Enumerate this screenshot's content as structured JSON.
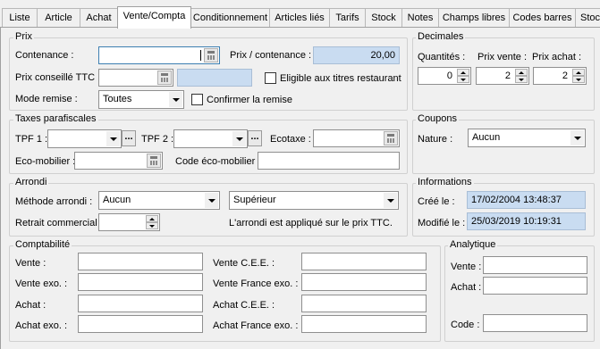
{
  "tabs": [
    "Liste",
    "Article",
    "Achat",
    "Vente/Compta",
    "Conditionnement",
    "Articles liés",
    "Tarifs",
    "Stock",
    "Notes",
    "Champs libres",
    "Codes barres",
    "Stoc"
  ],
  "prix": {
    "title": "Prix",
    "contenance_label": "Contenance :",
    "contenance_value": "",
    "prix_contenance_label": "Prix / contenance :",
    "prix_contenance_value": "20,00",
    "prix_conseille_label": "Prix conseillé TTC :",
    "prix_conseille_value": "",
    "eligible_label": "Eligible aux titres restaurant",
    "mode_remise_label": "Mode remise :",
    "mode_remise_value": "Toutes",
    "confirmer_label": "Confirmer la remise"
  },
  "decimales": {
    "title": "Decimales",
    "quantites_label": "Quantités :",
    "quantites_value": "0",
    "prix_vente_label": "Prix vente :",
    "prix_vente_value": "2",
    "prix_achat_label": "Prix achat :",
    "prix_achat_value": "2"
  },
  "taxes": {
    "title": "Taxes parafiscales",
    "tpf1_label": "TPF 1 :",
    "tpf2_label": "TPF 2 :",
    "ecotaxe_label": "Ecotaxe :",
    "ecomobilier_label": "Eco-mobilier :",
    "code_ecomobilier_label": "Code éco-mobilier :"
  },
  "coupons": {
    "title": "Coupons",
    "nature_label": "Nature :",
    "nature_value": "Aucun"
  },
  "arrondi": {
    "title": "Arrondi",
    "methode_label": "Méthode arrondi :",
    "methode_value": "Aucun",
    "sens_value": "Supérieur",
    "retrait_label": "Retrait commercial :",
    "retrait_value": "",
    "note": "L'arrondi est appliqué sur le prix TTC."
  },
  "informations": {
    "title": "Informations",
    "cree_label": "Créé le :",
    "cree_value": "17/02/2004 13:48:37",
    "modifie_label": "Modifié le :",
    "modifie_value": "25/03/2019 10:19:31"
  },
  "comptabilite": {
    "title": "Comptabilité",
    "vente_label": "Vente :",
    "vente_exo_label": "Vente exo. :",
    "achat_label": "Achat :",
    "achat_exo_label": "Achat exo. :",
    "vente_cee_label": "Vente C.E.E. :",
    "vente_france_exo_label": "Vente France exo. :",
    "achat_cee_label": "Achat C.E.E. :",
    "achat_france_exo_label": "Achat France exo. :"
  },
  "analytique": {
    "title": "Analytique",
    "vente_label": "Vente :",
    "achat_label": "Achat :",
    "code_label": "Code :"
  }
}
